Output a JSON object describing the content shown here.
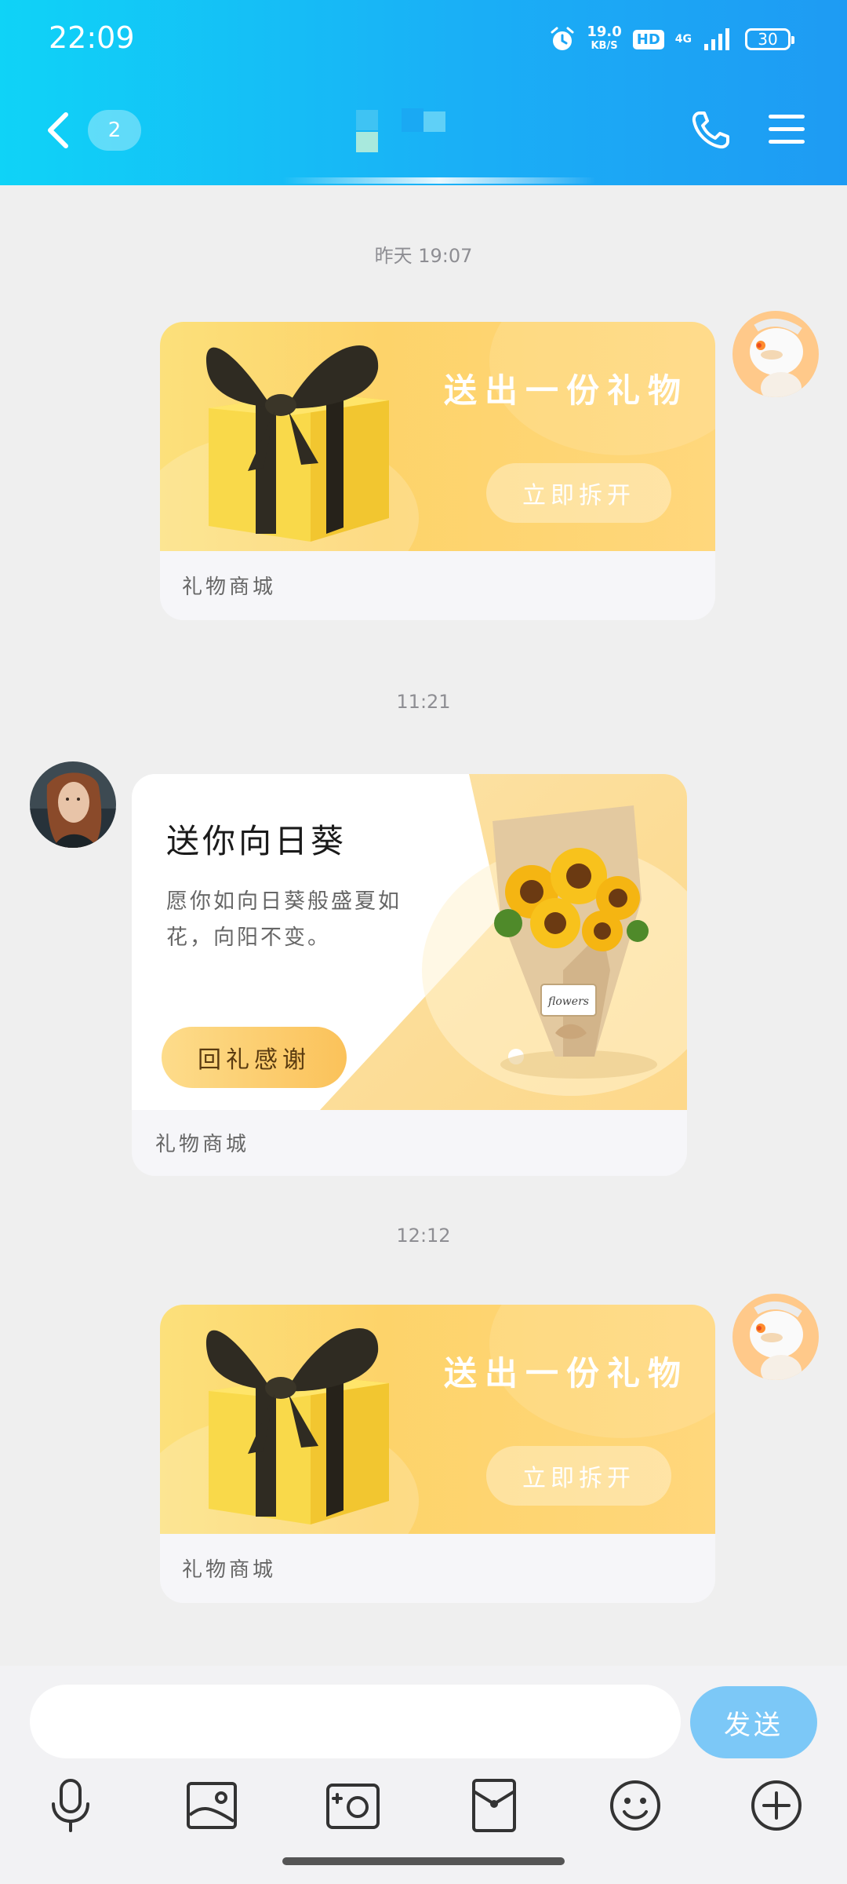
{
  "status_bar": {
    "time": "22:09",
    "net_speed_value": "19.0",
    "net_speed_unit": "KB/S",
    "hd": "HD",
    "network": "4G",
    "battery": "30",
    "icons": [
      "alarm-icon",
      "signal-icon"
    ]
  },
  "header": {
    "back_icon": "chevron-left-icon",
    "unread_count": "2",
    "call_icon": "phone-icon",
    "menu_icon": "menu-icon"
  },
  "messages": [
    {
      "type": "timestamp",
      "text": "昨天 19:07"
    },
    {
      "type": "gift",
      "side": "right",
      "title": "送出一份礼物",
      "button": "立即拆开",
      "source": "礼物商城"
    },
    {
      "type": "timestamp",
      "text": "11:21"
    },
    {
      "type": "flower",
      "side": "left",
      "title": "送你向日葵",
      "desc": "愿你如向日葵般盛夏如花，向阳不变。",
      "button": "回礼感谢",
      "source": "礼物商城",
      "wrap_label": "flowers"
    },
    {
      "type": "timestamp",
      "text": "12:12"
    },
    {
      "type": "gift",
      "side": "right",
      "title": "送出一份礼物",
      "button": "立即拆开",
      "source": "礼物商城"
    }
  ],
  "input": {
    "value": "",
    "send_label": "发送",
    "toolbar_icons": [
      "microphone-icon",
      "image-icon",
      "camera-icon",
      "red-packet-icon",
      "emoji-icon",
      "plus-icon"
    ]
  },
  "colors": {
    "header_start": "#0fd3f7",
    "header_end": "#1e9bf3",
    "send_button": "#7cc8f7",
    "gift_banner": "#fdd36a",
    "thanks_button": "#fbc25a"
  }
}
